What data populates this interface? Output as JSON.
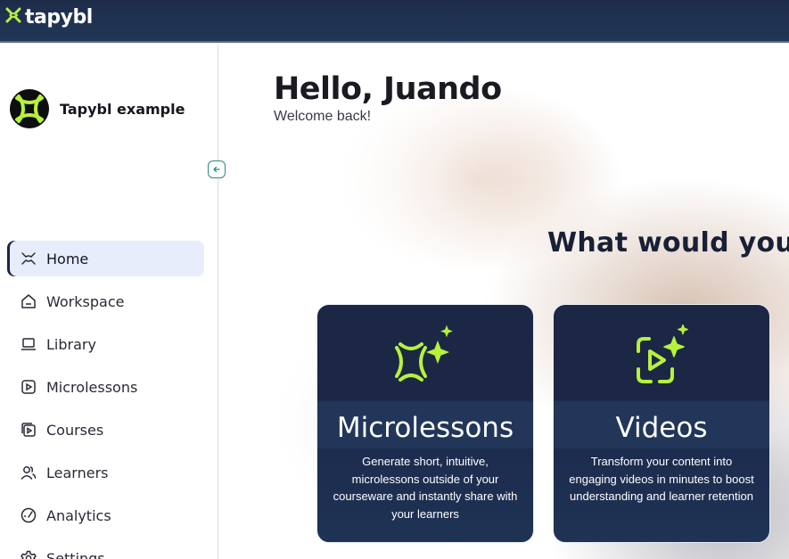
{
  "brand": {
    "name": "tapybl",
    "accent": "#b6f23a",
    "dark": "#1c2542"
  },
  "org": {
    "name": "Tapybl example"
  },
  "nav": {
    "items": [
      {
        "label": "Home",
        "icon": "home-spark-icon",
        "active": true
      },
      {
        "label": "Workspace",
        "icon": "house-icon"
      },
      {
        "label": "Library",
        "icon": "laptop-icon"
      },
      {
        "label": "Microlessons",
        "icon": "play-square-icon"
      },
      {
        "label": "Courses",
        "icon": "stacked-play-icon"
      },
      {
        "label": "Learners",
        "icon": "users-icon"
      },
      {
        "label": "Analytics",
        "icon": "gauge-icon"
      },
      {
        "label": "Settings",
        "icon": "gear-icon"
      }
    ]
  },
  "main": {
    "greeting": "Hello, Juando",
    "subtitle": "Welcome back!",
    "question": "What would you",
    "cards": [
      {
        "title": "Microlessons",
        "description": "Generate short, intuitive, microlessons outside of your courseware and instantly share with your learners",
        "icon": "microlesson-spark-icon"
      },
      {
        "title": "Videos",
        "description": "Transform your content into engaging videos in minutes to boost understanding and learner retention",
        "icon": "video-spark-icon"
      }
    ]
  }
}
